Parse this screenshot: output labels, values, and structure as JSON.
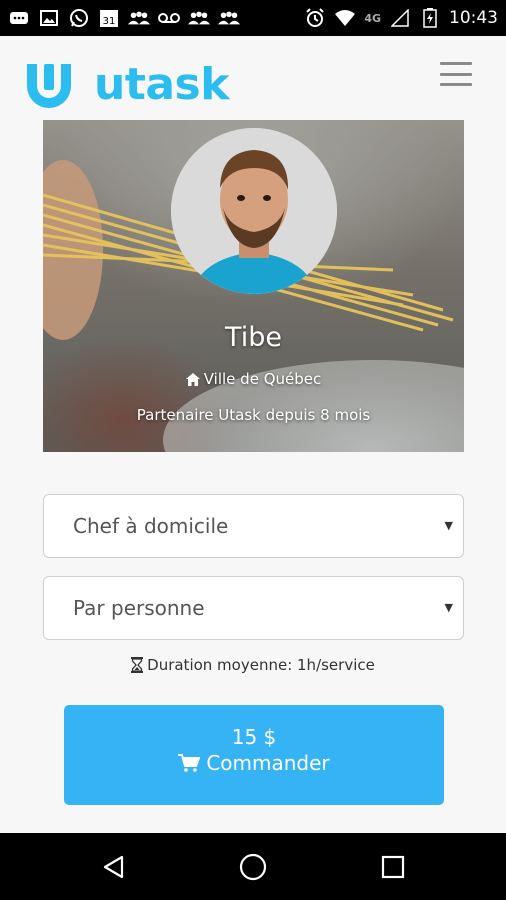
{
  "status_bar": {
    "time": "10:43",
    "network": "4G",
    "calendar_day": "31",
    "icons": [
      "message-icon",
      "image-icon",
      "whatsapp-icon",
      "calendar-icon",
      "group-icon",
      "voicemail-icon",
      "group-icon",
      "group-icon",
      "alarm-icon",
      "wifi-icon",
      "signal-icon",
      "battery-icon"
    ]
  },
  "header": {
    "logo_text": "utask",
    "brand_color": "#2bbdf0",
    "menu_icon": "hamburger-icon"
  },
  "profile": {
    "name": "Tibe",
    "location": "Ville de Québec",
    "location_icon": "home-icon",
    "partner_text": "Partenaire Utask depuis 8 mois"
  },
  "form": {
    "service_select": {
      "value": "Chef à domicile"
    },
    "pricing_select": {
      "value": "Par personne"
    },
    "duration_icon": "hourglass-icon",
    "duration_text": "Duration moyenne: 1h/service"
  },
  "order_button": {
    "price": "15 $",
    "label": "Commander",
    "icon": "cart-icon",
    "color": "#36b3f5"
  },
  "nav_bar": {
    "buttons": [
      "back-icon",
      "home-circle-icon",
      "recents-icon"
    ]
  }
}
